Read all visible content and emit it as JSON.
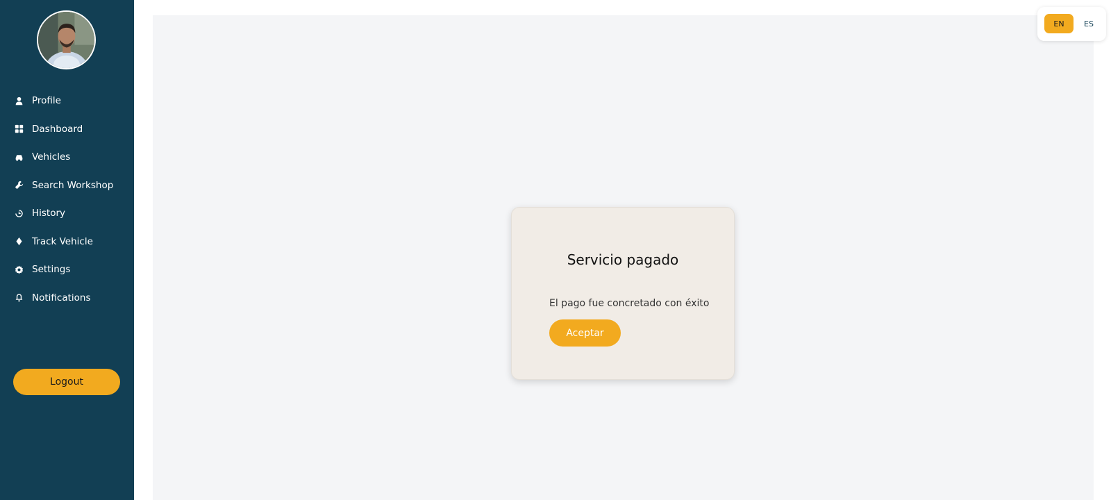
{
  "sidebar": {
    "items": [
      {
        "label": "Profile",
        "icon": "user-icon"
      },
      {
        "label": "Dashboard",
        "icon": "grid-icon"
      },
      {
        "label": "Vehicles",
        "icon": "car-icon"
      },
      {
        "label": "Search Workshop",
        "icon": "wrench-icon"
      },
      {
        "label": "History",
        "icon": "history-icon"
      },
      {
        "label": "Track Vehicle",
        "icon": "map-pin-icon"
      },
      {
        "label": "Settings",
        "icon": "gear-icon"
      },
      {
        "label": "Notifications",
        "icon": "bell-icon"
      }
    ],
    "logout_label": "Logout"
  },
  "modal": {
    "title": "Servicio pagado",
    "message": "El pago fue concretado con éxito",
    "button_label": "Aceptar"
  },
  "language": {
    "options": [
      "EN",
      "ES"
    ],
    "selected": "EN"
  },
  "colors": {
    "sidebar": "#123f54",
    "accent": "#f2aa1f",
    "main_bg": "#f4f5f7",
    "modal_bg": "#f1ece6"
  }
}
